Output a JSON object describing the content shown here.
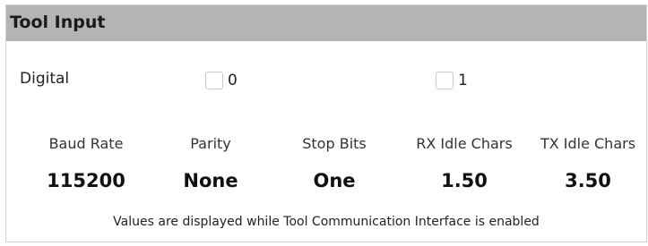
{
  "panel": {
    "title": "Tool Input"
  },
  "digital": {
    "label": "Digital",
    "inputs": [
      {
        "label": "0",
        "checked": false
      },
      {
        "label": "1",
        "checked": false
      }
    ]
  },
  "communication": {
    "columns": [
      {
        "header": "Baud Rate",
        "value": "115200"
      },
      {
        "header": "Parity",
        "value": "None"
      },
      {
        "header": "Stop Bits",
        "value": "One"
      },
      {
        "header": "RX Idle Chars",
        "value": "1.50"
      },
      {
        "header": "TX Idle Chars",
        "value": "3.50"
      }
    ],
    "note": "Values are displayed while Tool Communication Interface is enabled"
  },
  "colors": {
    "header_background": "#b4b4b4",
    "checkbox_border": "#c8c8c8"
  }
}
